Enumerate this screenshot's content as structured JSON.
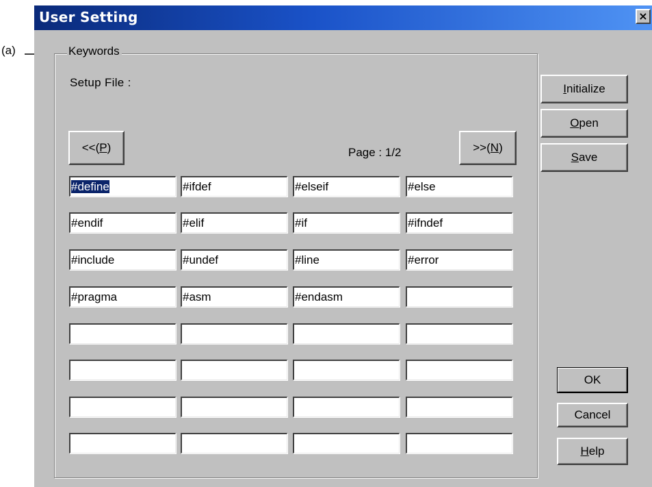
{
  "annotation": {
    "label": "(a)"
  },
  "window": {
    "title": "User Setting",
    "close_glyph": "×"
  },
  "keywords_group": {
    "legend": "Keywords",
    "setup_file_label": "Setup File  :",
    "prev_button": {
      "text": "<<(",
      "mnemonic": "P",
      "suffix": ")"
    },
    "next_button": {
      "text": ">>(",
      "mnemonic": "N",
      "suffix": ")"
    },
    "page_label": "Page : 1/2",
    "selected_cell": "#define",
    "keywords": [
      [
        "#define",
        "#ifdef",
        "#elseif",
        "#else"
      ],
      [
        "#endif",
        "#elif",
        "#if",
        "#ifndef"
      ],
      [
        "#include",
        "#undef",
        "#line",
        "#error"
      ],
      [
        "#pragma",
        "#asm",
        "#endasm",
        ""
      ],
      [
        "",
        "",
        "",
        ""
      ],
      [
        "",
        "",
        "",
        ""
      ],
      [
        "",
        "",
        "",
        ""
      ],
      [
        "",
        "",
        "",
        ""
      ]
    ]
  },
  "side_buttons": {
    "initialize": {
      "mnemonic": "I",
      "rest": "nitialize"
    },
    "open": {
      "mnemonic": "O",
      "rest": "pen"
    },
    "save": {
      "mnemonic": "S",
      "rest": "ave"
    },
    "ok": "OK",
    "cancel": "Cancel",
    "help": {
      "mnemonic": "H",
      "rest": "elp"
    }
  },
  "colors": {
    "titlebar_start": "#0a2a7a",
    "titlebar_end": "#4f93f4",
    "dialog_face": "#c0c0c0",
    "selection": "#0a246a"
  },
  "icons": {
    "pointer": "arrow-right-icon",
    "close": "close-icon"
  }
}
